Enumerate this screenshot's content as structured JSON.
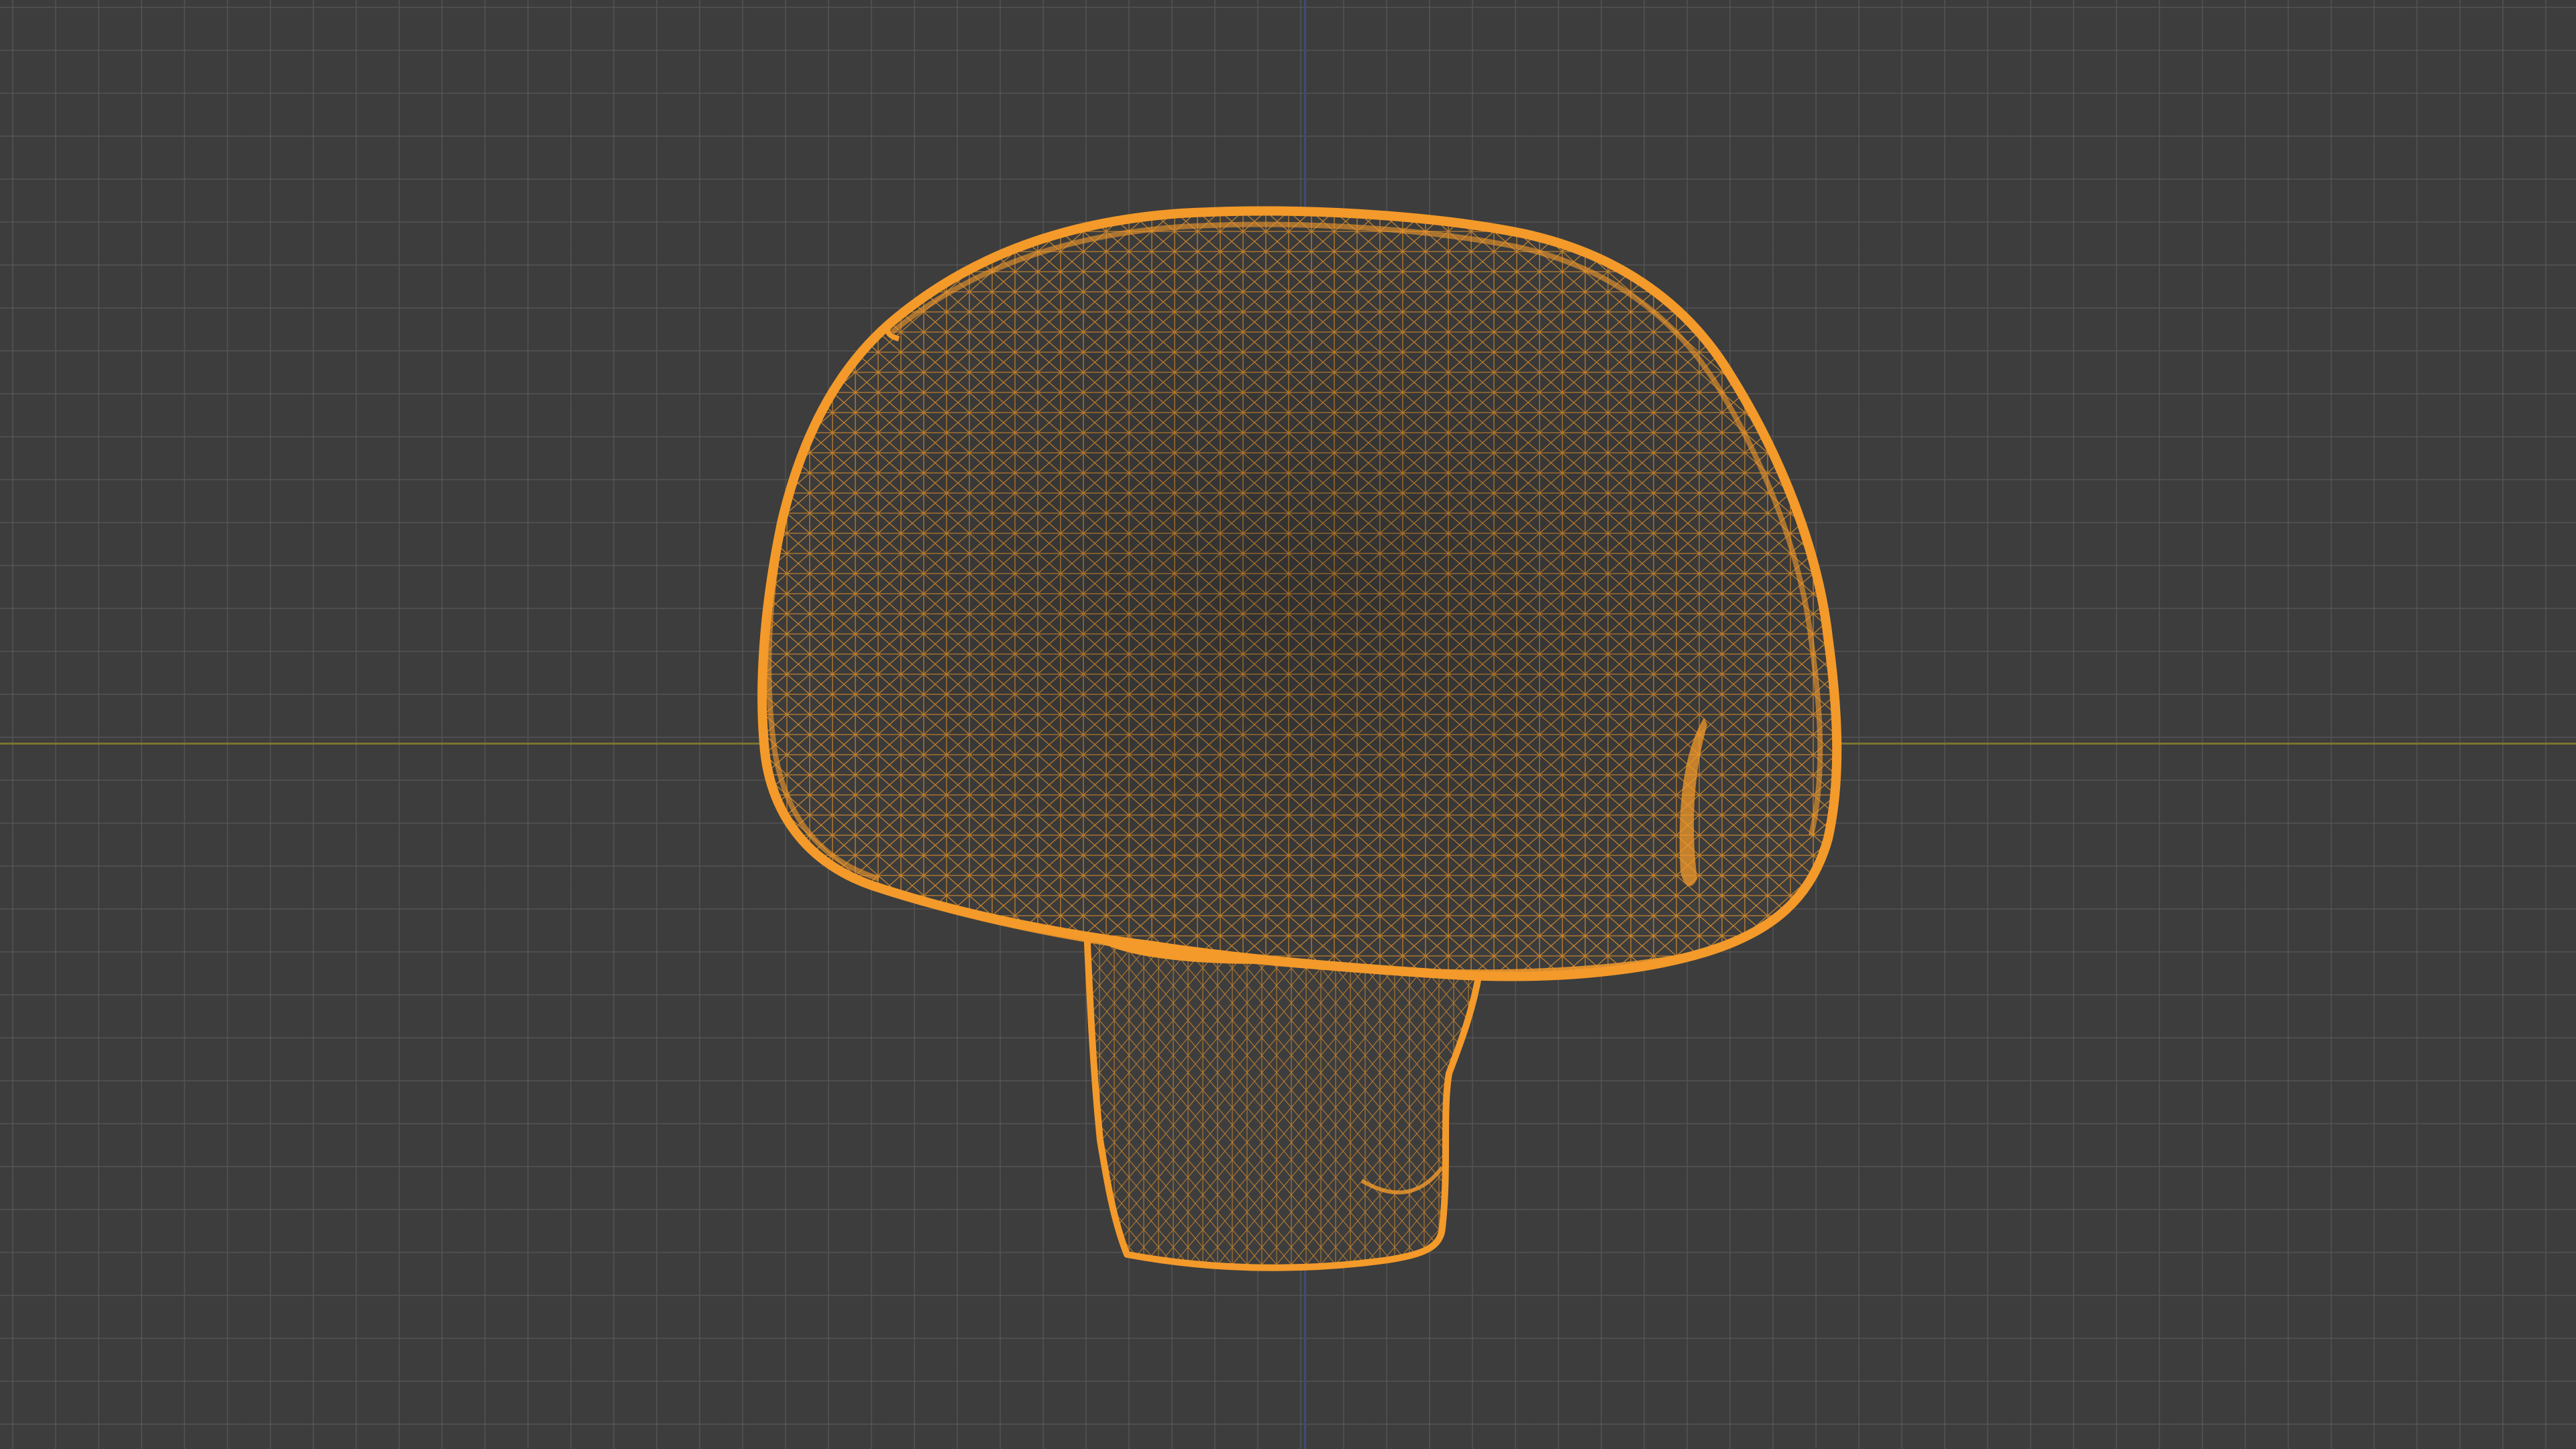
{
  "scene": {
    "view": "wireframe",
    "object": "mushroom-mesh",
    "colors": {
      "background": "#3d3d3d",
      "grid": "#4a4a4a",
      "x_axis": "#7a7530",
      "y_axis": "#3c4d7a",
      "wire": "#f39a2a"
    }
  }
}
